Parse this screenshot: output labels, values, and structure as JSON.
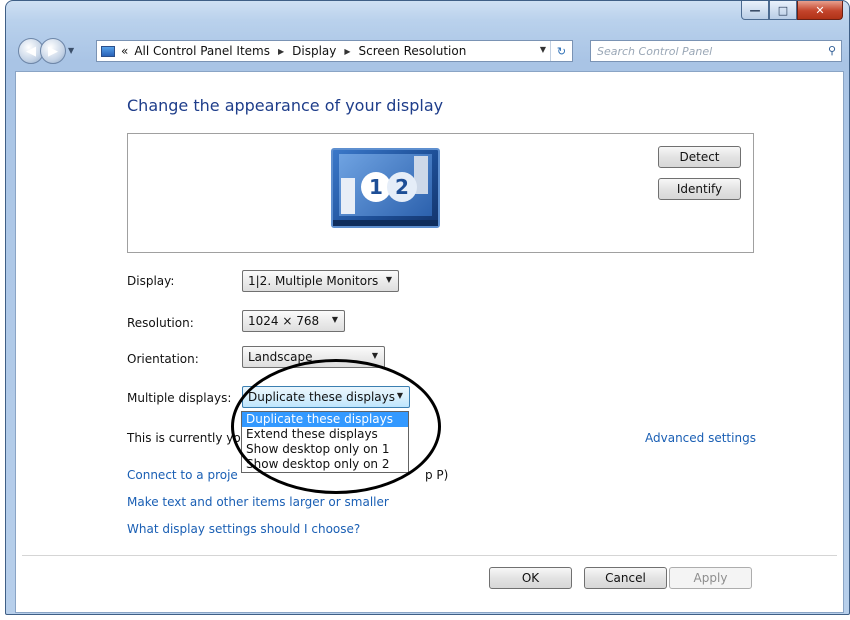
{
  "window": {
    "minimize_glyph": "—",
    "maximize_glyph": "□",
    "close_glyph": "✕"
  },
  "nav": {
    "back_glyph": "◀",
    "forward_glyph": "▶",
    "breadcrumb_prefix": "«",
    "breadcrumbs": [
      "All Control Panel Items",
      "Display",
      "Screen Resolution"
    ],
    "search_placeholder": "Search Control Panel"
  },
  "content": {
    "title": "Change the appearance of your display",
    "monitor_labels": [
      "1",
      "2"
    ],
    "detect_label": "Detect",
    "identify_label": "Identify",
    "display_label": "Display:",
    "display_value": "1|2. Multiple Monitors",
    "resolution_label": "Resolution:",
    "resolution_value": "1024 × 768",
    "orientation_label": "Orientation:",
    "orientation_value": "Landscape",
    "multiple_displays_label": "Multiple displays:",
    "multiple_displays_value": "Duplicate these displays",
    "multiple_displays_options": [
      "Duplicate these displays",
      "Extend these displays",
      "Show desktop only on 1",
      "Show desktop only on 2"
    ],
    "status_text": "This is currently you",
    "advanced_link": "Advanced settings",
    "link_projector": "Connect to a proje",
    "link_projector_tail": "p P)",
    "link_text_size": "Make text and other items larger or smaller",
    "link_help": "What display settings should I choose?",
    "ok_label": "OK",
    "cancel_label": "Cancel",
    "apply_label": "Apply"
  },
  "colors": {
    "link": "#1a5fb4",
    "title": "#1e3d8a",
    "selection": "#3399ff"
  }
}
